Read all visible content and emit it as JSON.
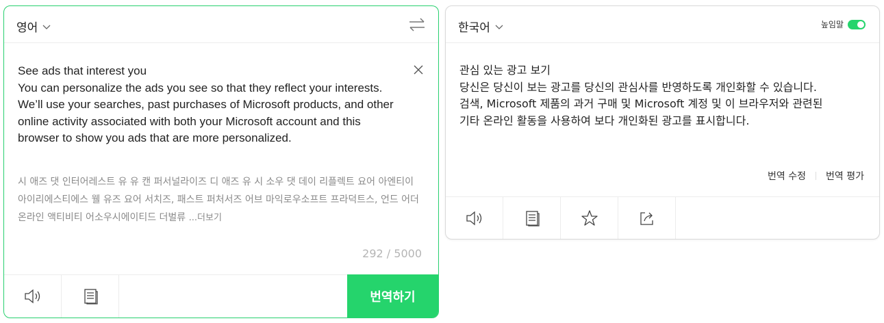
{
  "source": {
    "language": "영어",
    "text": "See ads that interest you\nYou can personalize the ads you see so that they reflect your interests. We’ll use your searches, past purchases of Microsoft products, and other online activity associated with both your Microsoft account and this browser to show you ads that are more personalized.",
    "pronunciation": "시 애즈 댓 인터어레스트 유 유 캔 퍼서널라이즈 디 애즈 유 시 소우 댓 데이 리플렉트 요어 아엔티이아이리에스티에스 웰 유즈 요어 서치즈, 패스트 퍼처서즈 어브 마익로우소프트 프라덕트스, 언드 어더 온라인 액티비티 어소우시에이티드 더벌류 ",
    "more_label": "...더보기",
    "char_count": "292 / 5000",
    "translate_button": "번역하기"
  },
  "target": {
    "language": "한국어",
    "honorific_label": "높임말",
    "honorific_on": true,
    "text": "관심 있는 광고 보기\n당신은 당신이 보는 광고를 당신의 관심사를 반영하도록 개인화할 수 있습니다.\n검색, Microsoft 제품의 과거 구매 및 Microsoft 계정 및 이 브라우저와 관련된\n기타 온라인 활동을 사용하여 보다 개인화된 광고를 표시합니다.",
    "edit_label": "번역 수정",
    "rate_label": "번역 평가"
  },
  "colors": {
    "accent": "#25d46c",
    "border_active": "#27d06e"
  }
}
